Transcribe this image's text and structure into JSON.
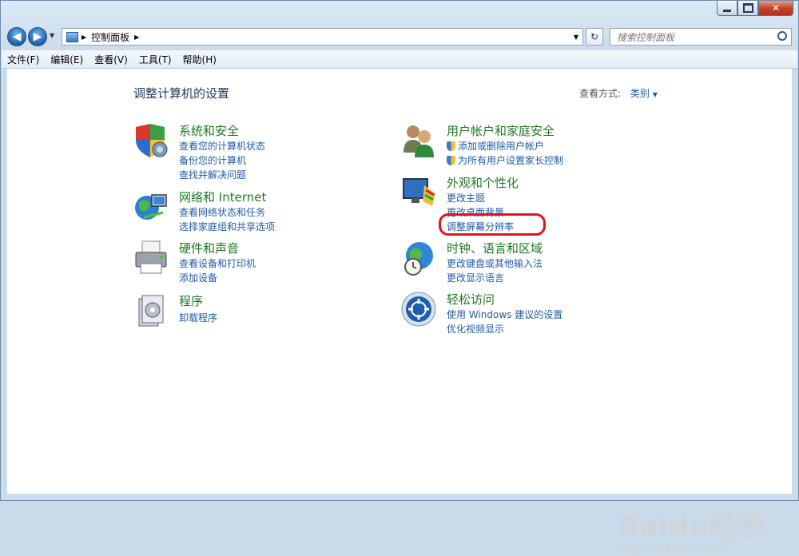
{
  "window": {
    "buttons": {
      "minimize": "–",
      "maximize": "□",
      "close": "✕"
    }
  },
  "address_bar": {
    "segments": [
      "控制面板"
    ],
    "search_placeholder": "搜索控制面板"
  },
  "menu": [
    "文件(F)",
    "编辑(E)",
    "查看(V)",
    "工具(T)",
    "帮助(H)"
  ],
  "page": {
    "title": "调整计算机的设置",
    "view_label": "查看方式:",
    "view_value": "类别"
  },
  "categories": {
    "system": {
      "title": "系统和安全",
      "links": [
        "查看您的计算机状态",
        "备份您的计算机",
        "查找并解决问题"
      ]
    },
    "network": {
      "title": "网络和 Internet",
      "links": [
        "查看网络状态和任务",
        "选择家庭组和共享选项"
      ]
    },
    "hardware": {
      "title": "硬件和声音",
      "links": [
        "查看设备和打印机",
        "添加设备"
      ]
    },
    "programs": {
      "title": "程序",
      "links": [
        "卸载程序"
      ]
    },
    "users": {
      "title": "用户帐户和家庭安全",
      "links": [
        "添加或删除用户帐户",
        "为所有用户设置家长控制"
      ]
    },
    "appearance": {
      "title": "外观和个性化",
      "links": [
        "更改主题",
        "更改桌面背景",
        "调整屏幕分辨率"
      ]
    },
    "clock": {
      "title": "时钟、语言和区域",
      "links": [
        "更改键盘或其他输入法",
        "更改显示语言"
      ]
    },
    "access": {
      "title": "轻松访问",
      "links": [
        "使用 Windows 建议的设置",
        "优化视频显示"
      ]
    }
  },
  "watermark": {
    "brand": "Baidu经验",
    "url": "jingyan.baidu.com"
  },
  "colors": {
    "link": "#1e5aa8",
    "category_heading": "#1d7a22",
    "highlight": "#e0141a"
  }
}
